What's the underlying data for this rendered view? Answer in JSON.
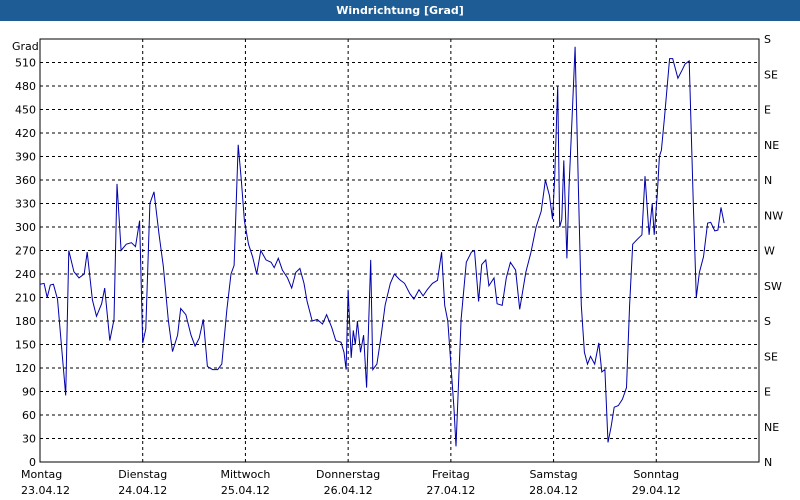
{
  "window": {
    "title": "Windrichtung [Grad]"
  },
  "colors": {
    "titlebar": "#1d5c94",
    "line": "#0000aa",
    "grid": "#000000"
  },
  "chart_data": {
    "type": "line",
    "title": "Windrichtung [Grad]",
    "ylabel": "Grad",
    "ylim": [
      0,
      540
    ],
    "y_ticks": [
      0,
      30,
      60,
      90,
      120,
      150,
      180,
      210,
      240,
      270,
      300,
      330,
      360,
      390,
      420,
      450,
      480,
      510
    ],
    "y2_ticks": [
      {
        "value": 0,
        "label": "N"
      },
      {
        "value": 45,
        "label": "NE"
      },
      {
        "value": 90,
        "label": "E"
      },
      {
        "value": 135,
        "label": "SE"
      },
      {
        "value": 180,
        "label": "S"
      },
      {
        "value": 225,
        "label": "SW"
      },
      {
        "value": 270,
        "label": "W"
      },
      {
        "value": 315,
        "label": "NW"
      },
      {
        "value": 360,
        "label": "N"
      },
      {
        "value": 405,
        "label": "NE"
      },
      {
        "value": 450,
        "label": "E"
      },
      {
        "value": 495,
        "label": "SE"
      },
      {
        "value": 540,
        "label": "S"
      }
    ],
    "grid": true,
    "xlim": [
      0,
      7
    ],
    "x_ticks": [
      {
        "value": 0,
        "day": "Montag",
        "date": "23.04.12"
      },
      {
        "value": 1,
        "day": "Dienstag",
        "date": "24.04.12"
      },
      {
        "value": 2,
        "day": "Mittwoch",
        "date": "25.04.12"
      },
      {
        "value": 3,
        "day": "Donnerstag",
        "date": "26.04.12"
      },
      {
        "value": 4,
        "day": "Freitag",
        "date": "27.04.12"
      },
      {
        "value": 5,
        "day": "Samstag",
        "date": "28.04.12"
      },
      {
        "value": 6,
        "day": "Sonntag",
        "date": "29.04.12"
      }
    ],
    "series": [
      {
        "points": [
          [
            0.0,
            227
          ],
          [
            0.04,
            228
          ],
          [
            0.07,
            210
          ],
          [
            0.1,
            226
          ],
          [
            0.13,
            227
          ],
          [
            0.17,
            208
          ],
          [
            0.25,
            85
          ],
          [
            0.28,
            270
          ],
          [
            0.33,
            243
          ],
          [
            0.38,
            235
          ],
          [
            0.43,
            240
          ],
          [
            0.46,
            268
          ],
          [
            0.51,
            207
          ],
          [
            0.55,
            186
          ],
          [
            0.6,
            202
          ],
          [
            0.63,
            222
          ],
          [
            0.68,
            155
          ],
          [
            0.72,
            182
          ],
          [
            0.75,
            355
          ],
          [
            0.79,
            270
          ],
          [
            0.84,
            278
          ],
          [
            0.89,
            280
          ],
          [
            0.93,
            275
          ],
          [
            0.97,
            308
          ],
          [
            1.0,
            152
          ],
          [
            1.03,
            170
          ],
          [
            1.07,
            330
          ],
          [
            1.11,
            345
          ],
          [
            1.16,
            290
          ],
          [
            1.2,
            250
          ],
          [
            1.25,
            180
          ],
          [
            1.29,
            141
          ],
          [
            1.34,
            162
          ],
          [
            1.37,
            196
          ],
          [
            1.42,
            188
          ],
          [
            1.47,
            162
          ],
          [
            1.51,
            148
          ],
          [
            1.55,
            158
          ],
          [
            1.59,
            182
          ],
          [
            1.63,
            122
          ],
          [
            1.68,
            118
          ],
          [
            1.73,
            118
          ],
          [
            1.77,
            125
          ],
          [
            1.82,
            195
          ],
          [
            1.86,
            240
          ],
          [
            1.89,
            251
          ],
          [
            1.93,
            405
          ],
          [
            1.96,
            360
          ],
          [
            1.99,
            308
          ],
          [
            2.03,
            278
          ],
          [
            2.07,
            262
          ],
          [
            2.11,
            240
          ],
          [
            2.15,
            270
          ],
          [
            2.2,
            258
          ],
          [
            2.25,
            255
          ],
          [
            2.28,
            248
          ],
          [
            2.32,
            260
          ],
          [
            2.36,
            245
          ],
          [
            2.41,
            235
          ],
          [
            2.45,
            222
          ],
          [
            2.49,
            242
          ],
          [
            2.53,
            247
          ],
          [
            2.57,
            228
          ],
          [
            2.6,
            205
          ],
          [
            2.65,
            180
          ],
          [
            2.7,
            182
          ],
          [
            2.75,
            176
          ],
          [
            2.79,
            188
          ],
          [
            2.84,
            172
          ],
          [
            2.88,
            155
          ],
          [
            2.93,
            153
          ],
          [
            2.96,
            140
          ],
          [
            2.98,
            118
          ],
          [
            3.0,
            220
          ],
          [
            3.03,
            133
          ],
          [
            3.05,
            168
          ],
          [
            3.07,
            150
          ],
          [
            3.09,
            180
          ],
          [
            3.12,
            140
          ],
          [
            3.15,
            162
          ],
          [
            3.18,
            95
          ],
          [
            3.22,
            258
          ],
          [
            3.24,
            118
          ],
          [
            3.28,
            125
          ],
          [
            3.32,
            160
          ],
          [
            3.36,
            200
          ],
          [
            3.41,
            228
          ],
          [
            3.45,
            240
          ],
          [
            3.5,
            233
          ],
          [
            3.55,
            228
          ],
          [
            3.6,
            215
          ],
          [
            3.64,
            208
          ],
          [
            3.69,
            220
          ],
          [
            3.73,
            212
          ],
          [
            3.77,
            220
          ],
          [
            3.82,
            228
          ],
          [
            3.87,
            232
          ],
          [
            3.91,
            268
          ],
          [
            3.94,
            200
          ],
          [
            3.97,
            180
          ],
          [
            4.03,
            70
          ],
          [
            4.05,
            20
          ],
          [
            4.1,
            182
          ],
          [
            4.15,
            255
          ],
          [
            4.2,
            268
          ],
          [
            4.23,
            270
          ],
          [
            4.27,
            205
          ],
          [
            4.3,
            252
          ],
          [
            4.34,
            258
          ],
          [
            4.37,
            225
          ],
          [
            4.42,
            235
          ],
          [
            4.45,
            202
          ],
          [
            4.5,
            200
          ],
          [
            4.54,
            235
          ],
          [
            4.58,
            255
          ],
          [
            4.63,
            245
          ],
          [
            4.67,
            195
          ],
          [
            4.73,
            242
          ],
          [
            4.78,
            268
          ],
          [
            4.83,
            300
          ],
          [
            4.88,
            320
          ],
          [
            4.92,
            360
          ],
          [
            4.96,
            340
          ],
          [
            4.99,
            310
          ],
          [
            5.01,
            360
          ],
          [
            5.04,
            480
          ],
          [
            5.06,
            300
          ],
          [
            5.08,
            310
          ],
          [
            5.1,
            385
          ],
          [
            5.13,
            260
          ],
          [
            5.15,
            350
          ],
          [
            5.18,
            440
          ],
          [
            5.21,
            530
          ],
          [
            5.24,
            360
          ],
          [
            5.27,
            200
          ],
          [
            5.3,
            140
          ],
          [
            5.33,
            125
          ],
          [
            5.36,
            135
          ],
          [
            5.4,
            125
          ],
          [
            5.44,
            152
          ],
          [
            5.47,
            115
          ],
          [
            5.5,
            118
          ],
          [
            5.53,
            25
          ],
          [
            5.56,
            45
          ],
          [
            5.59,
            70
          ],
          [
            5.63,
            72
          ],
          [
            5.67,
            80
          ],
          [
            5.71,
            95
          ],
          [
            5.74,
            200
          ],
          [
            5.77,
            278
          ],
          [
            5.82,
            285
          ],
          [
            5.86,
            290
          ],
          [
            5.89,
            365
          ],
          [
            5.93,
            290
          ],
          [
            5.96,
            330
          ],
          [
            5.98,
            290
          ],
          [
            6.01,
            342
          ],
          [
            6.03,
            390
          ],
          [
            6.05,
            398
          ],
          [
            6.08,
            440
          ],
          [
            6.13,
            515
          ],
          [
            6.16,
            515
          ],
          [
            6.21,
            490
          ],
          [
            6.25,
            500
          ],
          [
            6.28,
            508
          ],
          [
            6.32,
            512
          ],
          [
            6.36,
            330
          ],
          [
            6.39,
            210
          ],
          [
            6.42,
            242
          ],
          [
            6.46,
            262
          ],
          [
            6.5,
            305
          ],
          [
            6.53,
            306
          ],
          [
            6.57,
            295
          ],
          [
            6.6,
            296
          ],
          [
            6.63,
            325
          ],
          [
            6.66,
            305
          ]
        ]
      }
    ]
  }
}
